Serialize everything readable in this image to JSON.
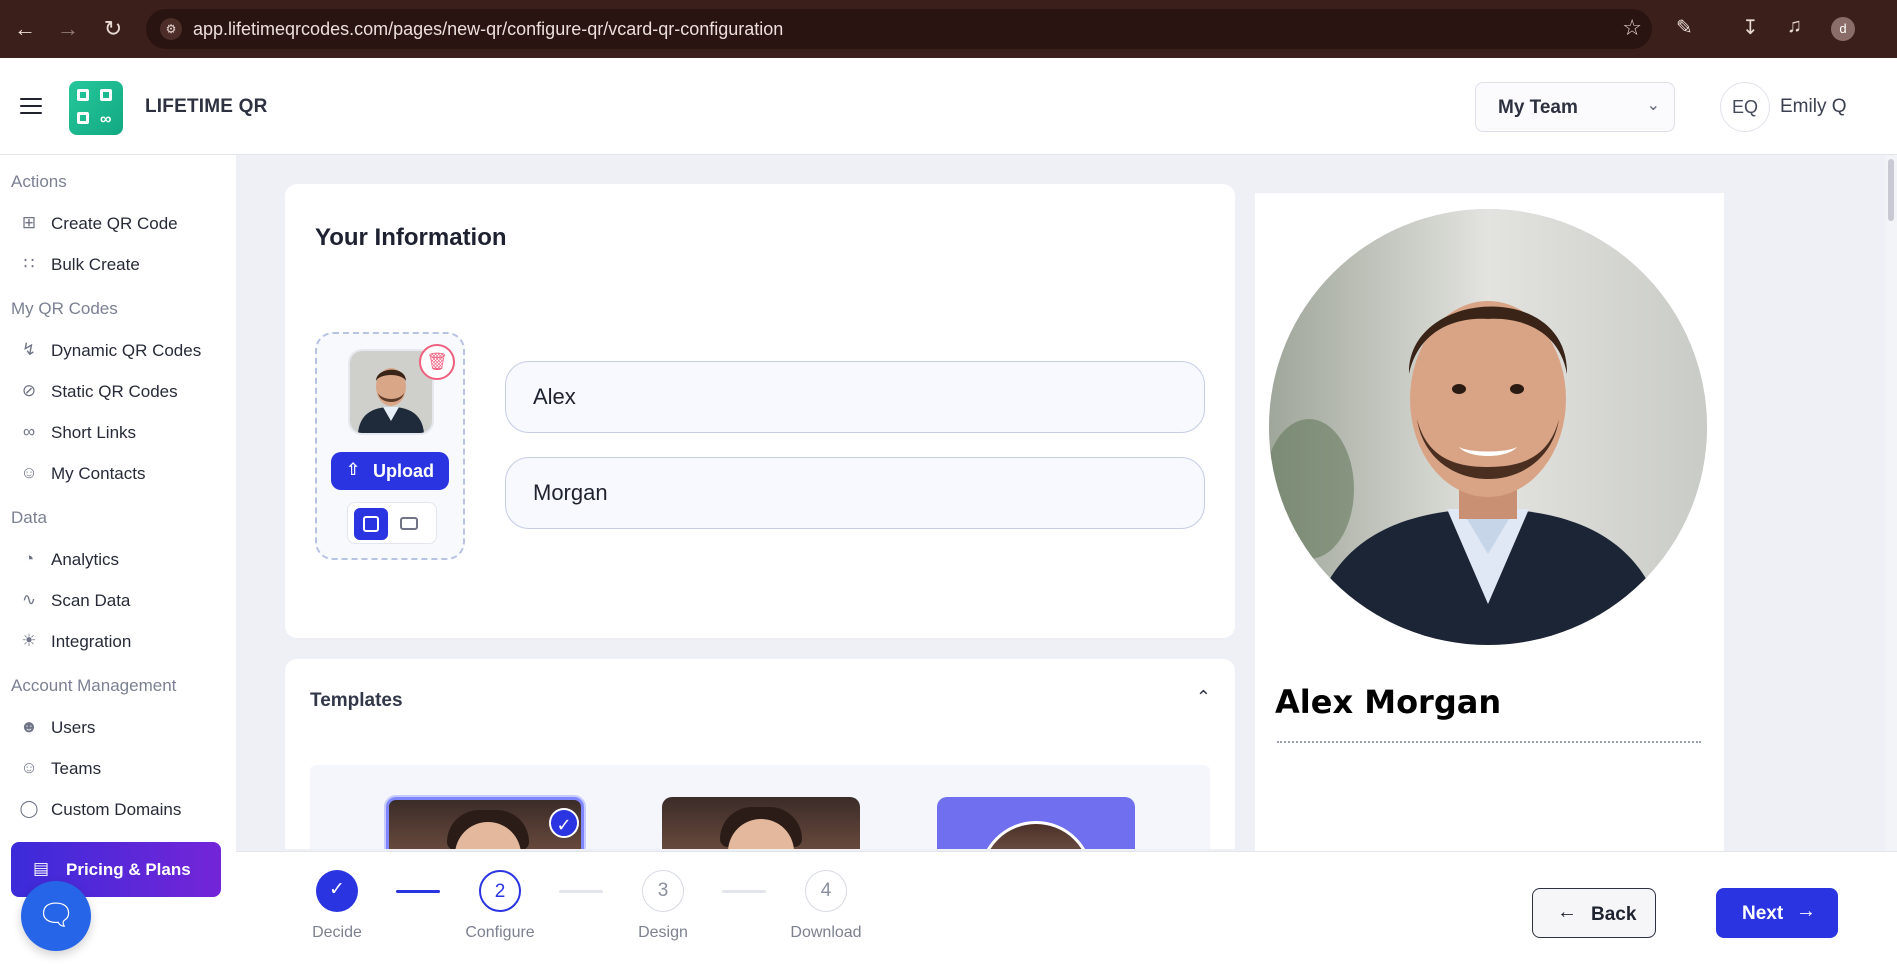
{
  "browser": {
    "url": "app.lifetimeqrcodes.com/pages/new-qr/configure-qr/vcard-qr-configuration",
    "profile_initial": "d"
  },
  "header": {
    "brand": "LIFETIME QR",
    "team_select": "My Team",
    "user_initials": "EQ",
    "user_name": "Emily Q"
  },
  "sidebar": {
    "sections": {
      "actions": "Actions",
      "my_qr_codes": "My QR Codes",
      "data": "Data",
      "account_management": "Account Management"
    },
    "items": {
      "create_qr": "Create QR Code",
      "bulk_create": "Bulk Create",
      "dynamic_qr": "Dynamic QR Codes",
      "static_qr": "Static QR Codes",
      "short_links": "Short Links",
      "my_contacts": "My Contacts",
      "analytics": "Analytics",
      "scan_data": "Scan Data",
      "integration": "Integration",
      "users": "Users",
      "teams": "Teams",
      "custom_domains": "Custom Domains"
    },
    "pricing": "Pricing & Plans"
  },
  "info": {
    "title": "Your Information",
    "upload_label": "Upload",
    "first_name": "Alex",
    "last_name": "Morgan"
  },
  "templates": {
    "title": "Templates"
  },
  "preview": {
    "name": "Alex Morgan"
  },
  "stepper": {
    "steps": [
      {
        "number": "1",
        "label": "Decide",
        "state": "done"
      },
      {
        "number": "2",
        "label": "Configure",
        "state": "active"
      },
      {
        "number": "3",
        "label": "Design",
        "state": "todo"
      },
      {
        "number": "4",
        "label": "Download",
        "state": "todo"
      }
    ],
    "back": "Back",
    "next": "Next"
  },
  "colors": {
    "primary": "#2a34e0",
    "brand_green": "#1fb98f",
    "pricing_gradient_start": "#3b2bd9",
    "pricing_gradient_end": "#7425d8",
    "delete_red": "#ef5f7e",
    "browser_bar": "#3b1f1a"
  }
}
